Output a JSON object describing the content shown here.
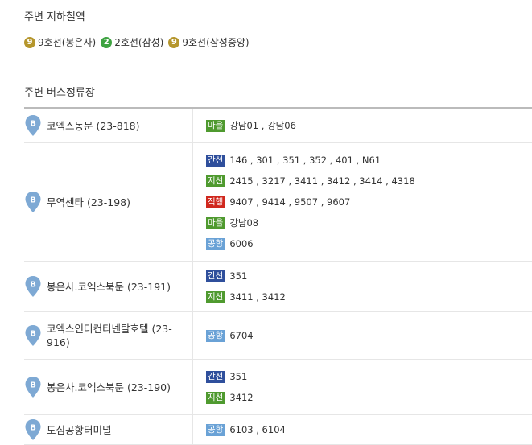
{
  "subway": {
    "title": "주변 지하철역",
    "lines": [
      {
        "badge": "9",
        "label": "9호선(봉은사)",
        "color": "#b5962c"
      },
      {
        "badge": "2",
        "label": "2호선(삼성)",
        "color": "#3ea341"
      },
      {
        "badge": "9",
        "label": "9호선(삼성중앙)",
        "color": "#b5962c"
      }
    ]
  },
  "bus": {
    "title": "주변 버스정류장",
    "pin_letter": "B",
    "pin_color": "#7ea9d4",
    "type_colors": {
      "마을": "#4f9a2f",
      "간선": "#2f4f9c",
      "지선": "#4f9a2f",
      "직행": "#d0281e",
      "공항": "#6aa2d6"
    },
    "stops": [
      {
        "name": "코엑스동문 (23-818)",
        "routes": [
          {
            "type": "마을",
            "numbers": "강남01 , 강남06"
          }
        ]
      },
      {
        "name": "무역센타 (23-198)",
        "routes": [
          {
            "type": "간선",
            "numbers": "146 , 301 , 351 , 352 , 401 , N61"
          },
          {
            "type": "지선",
            "numbers": "2415 , 3217 , 3411 , 3412 , 3414 , 4318"
          },
          {
            "type": "직행",
            "numbers": "9407 , 9414 , 9507 , 9607"
          },
          {
            "type": "마을",
            "numbers": "강남08"
          },
          {
            "type": "공항",
            "numbers": "6006"
          }
        ]
      },
      {
        "name": "봉은사.코엑스북문 (23-191)",
        "routes": [
          {
            "type": "간선",
            "numbers": "351"
          },
          {
            "type": "지선",
            "numbers": "3411 , 3412"
          }
        ]
      },
      {
        "name": "코엑스인터컨티넨탈호텔 (23-916)",
        "routes": [
          {
            "type": "공항",
            "numbers": "6704"
          }
        ]
      },
      {
        "name": "봉은사.코엑스북문 (23-190)",
        "routes": [
          {
            "type": "간선",
            "numbers": "351"
          },
          {
            "type": "지선",
            "numbers": "3412"
          }
        ]
      },
      {
        "name": "도심공항터미널",
        "routes": [
          {
            "type": "공항",
            "numbers": "6103 , 6104"
          }
        ]
      }
    ]
  }
}
